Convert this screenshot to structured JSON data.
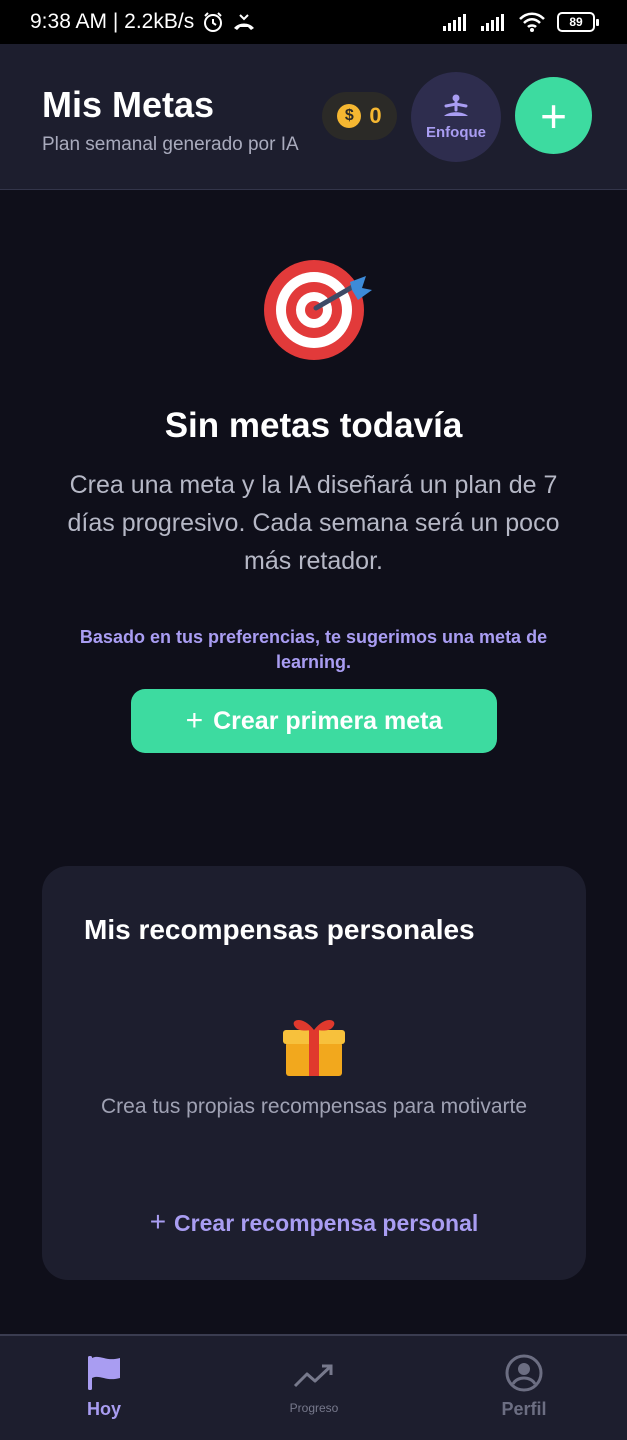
{
  "status_bar": {
    "time_speed": "9:38 AM | 2.2kB/s",
    "battery": "89"
  },
  "header": {
    "title": "Mis Metas",
    "subtitle": "Plan semanal generado por IA",
    "coins": "0",
    "coin_symbol": "$",
    "focus_label": "Enfoque",
    "add_label": "+"
  },
  "empty_state": {
    "icon": "target-dart-icon",
    "title": "Sin metas todavía",
    "description": "Crea una meta y la IA diseñará un plan de 7 días progresivo. Cada semana será un poco más retador.",
    "suggestion": "Basado en tus preferencias, te sugerimos una meta de learning.",
    "create_button": "Crear primera meta"
  },
  "rewards": {
    "title": "Mis recompensas personales",
    "icon": "gift-icon",
    "description": "Crea tus propias recompensas para motivarte",
    "create_link": "Crear recompensa personal"
  },
  "bottom_nav": {
    "items": [
      {
        "label": "Hoy",
        "icon": "flag-icon",
        "active": true
      },
      {
        "label": "Progreso",
        "icon": "trending-up-icon",
        "active": false
      },
      {
        "label": "Perfil",
        "icon": "profile-icon",
        "active": false
      }
    ]
  },
  "colors": {
    "background": "#0f0f1a",
    "surface": "#1d1e2e",
    "accent_green": "#3ddba0",
    "accent_purple": "#a99df2",
    "coin_gold": "#f5b731"
  }
}
